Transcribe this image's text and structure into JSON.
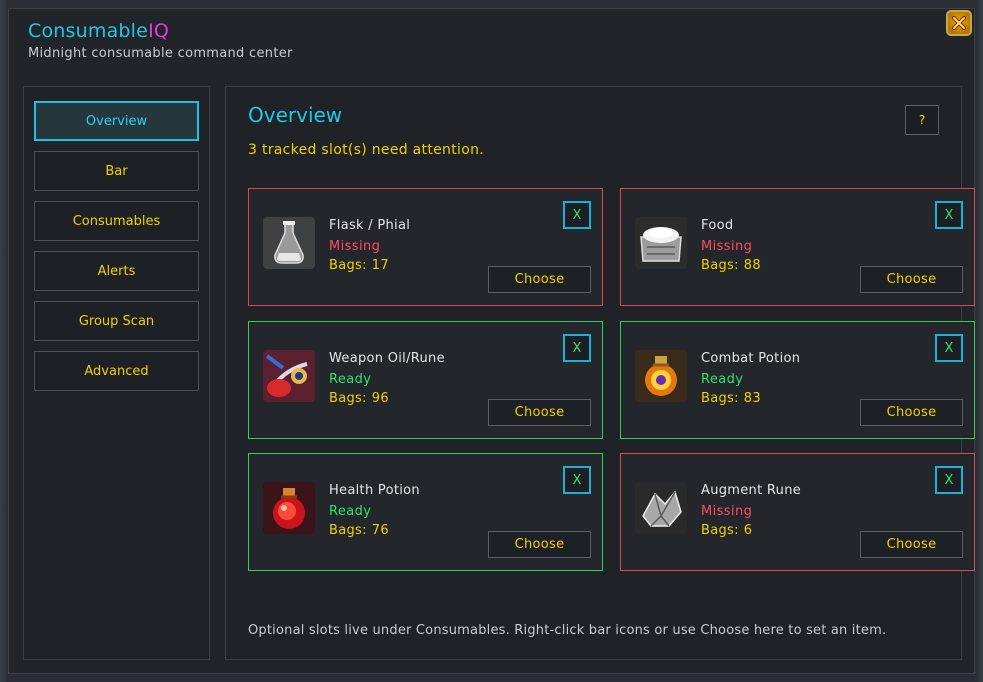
{
  "window": {
    "brand_main": "Consumable",
    "brand_accent": "IQ",
    "subtitle": "Midnight consumable command center",
    "close_icon": "close-icon"
  },
  "colors": {
    "accent_cyan": "#22c7e6",
    "accent_magenta": "#e23cd8",
    "label_yellow": "#f2d000",
    "missing_red": "#ff4a63",
    "ready_green": "#2ee36b"
  },
  "sidebar": {
    "items": [
      {
        "label": "Overview",
        "active": true
      },
      {
        "label": "Bar",
        "active": false
      },
      {
        "label": "Consumables",
        "active": false
      },
      {
        "label": "Alerts",
        "active": false
      },
      {
        "label": "Group Scan",
        "active": false
      },
      {
        "label": "Advanced",
        "active": false
      }
    ]
  },
  "main": {
    "title": "Overview",
    "help_label": "?",
    "attention_text": "3 tracked slot(s) need attention.",
    "footer_note": "Optional slots live under Consumables. Right-click bar icons or use Choose here to set an item.",
    "cards": [
      {
        "name": "Flask / Phial",
        "status": "Missing",
        "state": "missing",
        "bags_label": "Bags:",
        "bags": "17",
        "x_label": "X",
        "choose_label": "Choose",
        "icon": "flask-icon"
      },
      {
        "name": "Food",
        "status": "Missing",
        "state": "missing",
        "bags_label": "Bags:",
        "bags": "88",
        "x_label": "X",
        "choose_label": "Choose",
        "icon": "food-icon"
      },
      {
        "name": "Weapon Oil/Rune",
        "status": "Ready",
        "state": "ready",
        "bags_label": "Bags:",
        "bags": "96",
        "x_label": "X",
        "choose_label": "Choose",
        "icon": "weapon-oil-icon"
      },
      {
        "name": "Combat Potion",
        "status": "Ready",
        "state": "ready",
        "bags_label": "Bags:",
        "bags": "83",
        "x_label": "X",
        "choose_label": "Choose",
        "icon": "combat-potion-icon"
      },
      {
        "name": "Health Potion",
        "status": "Ready",
        "state": "ready",
        "bags_label": "Bags:",
        "bags": "76",
        "x_label": "X",
        "choose_label": "Choose",
        "icon": "health-potion-icon"
      },
      {
        "name": "Augment Rune",
        "status": "Missing",
        "state": "missing",
        "bags_label": "Bags:",
        "bags": "6",
        "x_label": "X",
        "choose_label": "Choose",
        "icon": "augment-rune-icon"
      }
    ]
  }
}
